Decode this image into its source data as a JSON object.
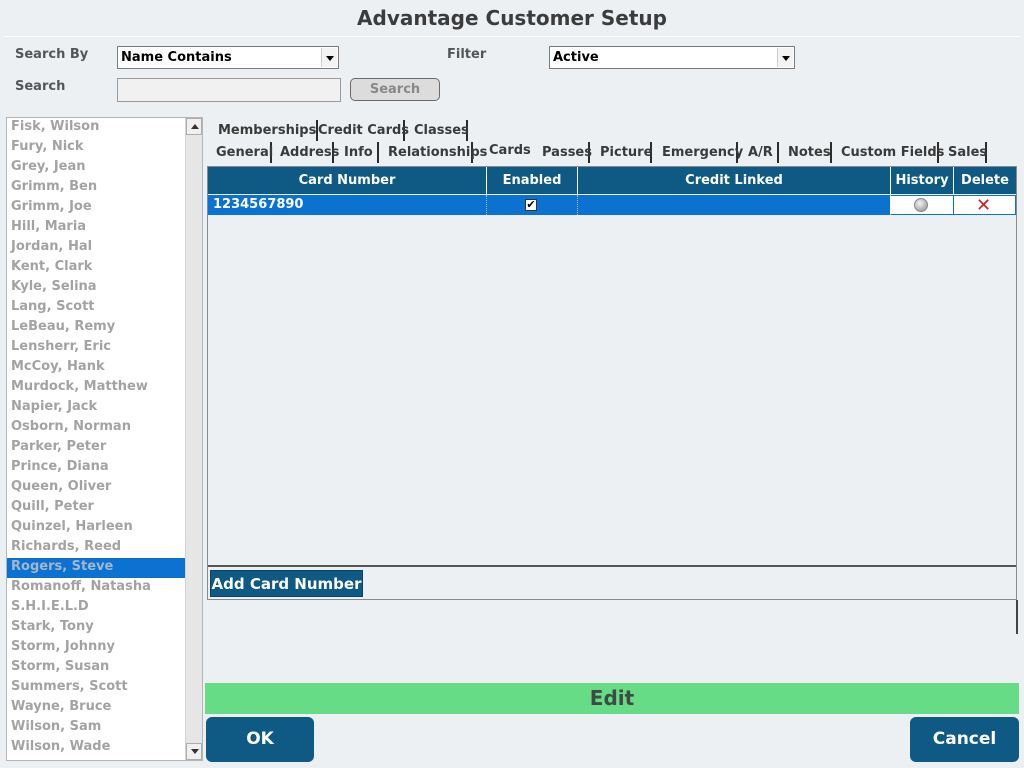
{
  "window": {
    "title": "Advantage Customer Setup"
  },
  "search": {
    "search_by_label": "Search By",
    "search_by_value": "Name Contains",
    "filter_label": "Filter",
    "filter_value": "Active",
    "search_label": "Search",
    "search_input_value": "",
    "search_button": "Search"
  },
  "customers": [
    "Fisk, Wilson",
    "Fury, Nick",
    "Grey, Jean",
    "Grimm, Ben",
    "Grimm, Joe",
    "Hill, Maria",
    "Jordan, Hal",
    "Kent, Clark",
    "Kyle, Selina",
    "Lang, Scott",
    "LeBeau, Remy",
    "Lensherr, Eric",
    "McCoy, Hank",
    "Murdock, Matthew",
    "Napier, Jack",
    "Osborn, Norman",
    "Parker, Peter",
    "Prince, Diana",
    "Queen, Oliver",
    "Quill, Peter",
    "Quinzel, Harleen",
    "Richards, Reed",
    "Rogers, Steve",
    "Romanoff, Natasha",
    "S.H.I.E.L.D",
    "Stark, Tony",
    "Storm, Johnny",
    "Storm, Susan",
    "Summers, Scott",
    "Wayne, Bruce",
    "Wilson, Sam",
    "Wilson, Wade"
  ],
  "selected_customer": "Rogers, Steve",
  "tabs_row1": [
    "Memberships",
    "Credit Cards",
    "Classes"
  ],
  "tabs_row2": [
    "General",
    "Address",
    "Info",
    "Relationships",
    "Cards",
    "Passes",
    "Picture",
    "Emergency",
    "A/R",
    "Notes",
    "Custom Fields",
    "Sales"
  ],
  "active_tab": "Cards",
  "cards_table": {
    "headers": [
      "Card Number",
      "Enabled",
      "Credit Linked",
      "History",
      "Delete"
    ],
    "rows": [
      {
        "card_number": "1234567890",
        "enabled": true,
        "enabled_mark": "✔",
        "credit_linked": ""
      }
    ]
  },
  "buttons": {
    "add_card": "Add Card Number",
    "ok": "OK",
    "cancel": "Cancel"
  },
  "mode_banner": "Edit",
  "icons": {
    "history": "circle-icon",
    "delete": "x-icon",
    "delete_glyph": "✕"
  },
  "colors": {
    "header_blue": "#0e5a85",
    "selection_blue": "#0b72d2",
    "edit_green": "#66dc86"
  }
}
